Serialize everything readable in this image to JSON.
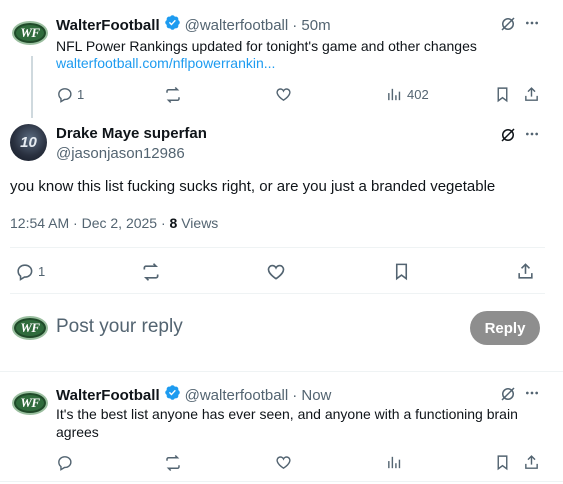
{
  "quoted_tweet": {
    "author_name": "WalterFootball",
    "avatar_text": "WF",
    "handle": "@walterfootball",
    "time": "· 50m",
    "text": "NFL Power Rankings updated for tonight's game and other changes",
    "link": "walterfootball.com/nflpowerrankin...",
    "replies": "1",
    "views": "402"
  },
  "main_tweet": {
    "author_name": "Drake Maye superfan",
    "avatar_text": "10",
    "handle": "@jasonjason12986",
    "text": "you know this list fucking sucks right, or are you just a branded vegetable",
    "timestamp": "12:54 AM · Dec 2, 2025 · ",
    "views_count": "8",
    "views_label": " Views",
    "replies": "1"
  },
  "composer": {
    "avatar_text": "WF",
    "placeholder": "Post your reply",
    "button_label": "Reply"
  },
  "reply_tweet": {
    "author_name": "WalterFootball",
    "avatar_text": "WF",
    "handle": "@walterfootball",
    "time": "· Now",
    "text": "It's the best list anyone has ever seen, and anyone with  a functioning brain agrees"
  },
  "colors": {
    "accent": "#1d9bf0",
    "muted": "#536471",
    "verified": "#1d9bf0",
    "reply_button": "#8e8e8e"
  }
}
